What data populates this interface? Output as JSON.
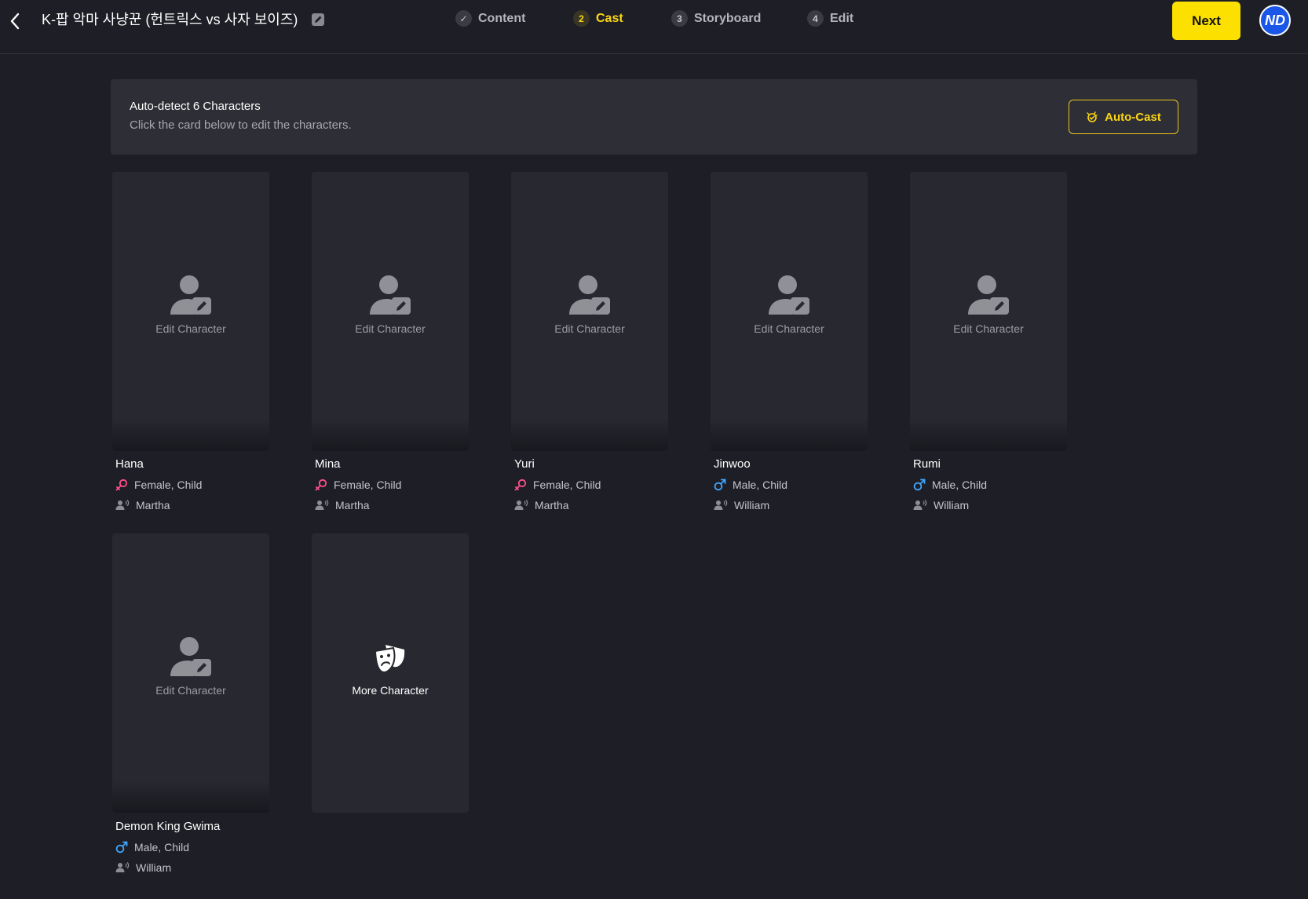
{
  "header": {
    "title": "K-팝 악마 사냥꾼 (헌트릭스 vs 사자 보이즈)",
    "steps": [
      {
        "num": "✓",
        "label": "Content"
      },
      {
        "num": "2",
        "label": "Cast"
      },
      {
        "num": "3",
        "label": "Storyboard"
      },
      {
        "num": "4",
        "label": "Edit"
      }
    ],
    "next_label": "Next",
    "avatar_initials": "ND"
  },
  "banner": {
    "title": "Auto-detect 6 Characters",
    "subtitle": "Click the card below to edit the characters.",
    "autocast_label": "Auto-Cast"
  },
  "colors": {
    "accent": "#fce100",
    "female_icon": "#ff4f8b",
    "male_icon": "#3fa7ff",
    "avatar": "#1a56e8"
  },
  "card_edit_label": "Edit Character",
  "characters": [
    {
      "name": "Hana",
      "gender": "female",
      "traits": "Female, Child",
      "voice": "Martha"
    },
    {
      "name": "Mina",
      "gender": "female",
      "traits": "Female, Child",
      "voice": "Martha"
    },
    {
      "name": "Yuri",
      "gender": "female",
      "traits": "Female, Child",
      "voice": "Martha"
    },
    {
      "name": "Jinwoo",
      "gender": "male",
      "traits": "Male, Child",
      "voice": "William"
    },
    {
      "name": "Rumi",
      "gender": "male",
      "traits": "Male, Child",
      "voice": "William"
    },
    {
      "name": "Demon King Gwima",
      "gender": "male",
      "traits": "Male, Child",
      "voice": "William"
    }
  ],
  "more_card_label": "More Character"
}
